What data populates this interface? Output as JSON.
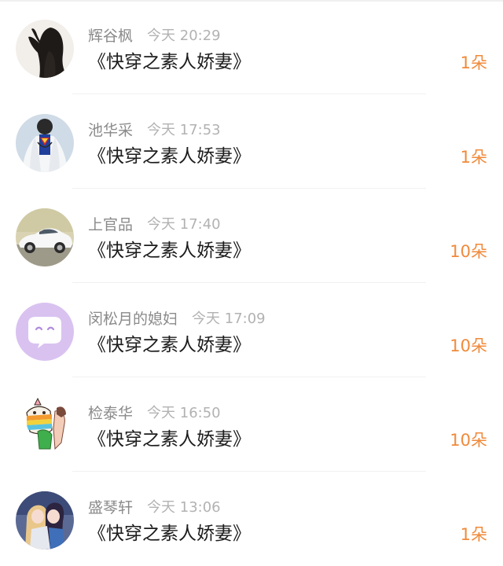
{
  "records": [
    {
      "user": "辉谷枫",
      "time": "今天 20:29",
      "book": "《快穿之素人娇妻》",
      "gift": "1朵",
      "avatar": "dark-hair-woman"
    },
    {
      "user": "池华采",
      "time": "今天 17:53",
      "book": "《快穿之素人娇妻》",
      "gift": "1朵",
      "avatar": "superman-shirt"
    },
    {
      "user": "上官品",
      "time": "今天 17:40",
      "book": "《快穿之素人娇妻》",
      "gift": "10朵",
      "avatar": "white-sports-car"
    },
    {
      "user": "闵松月的媳妇",
      "time": "今天 17:09",
      "book": "《快穿之素人娇妻》",
      "gift": "10朵",
      "avatar": "purple-chat-bubble"
    },
    {
      "user": "检泰华",
      "time": "今天 16:50",
      "book": "《快穿之素人娇妻》",
      "gift": "10朵",
      "avatar": "cartoon-unicorn"
    },
    {
      "user": "盛琴轩",
      "time": "今天 13:06",
      "book": "《快穿之素人娇妻》",
      "gift": "1朵",
      "avatar": "anime-couple"
    }
  ],
  "colors": {
    "gift": "#f08a3b",
    "username": "#8a8a8a",
    "time": "#b2b2b2",
    "title": "#1c1c1c"
  }
}
